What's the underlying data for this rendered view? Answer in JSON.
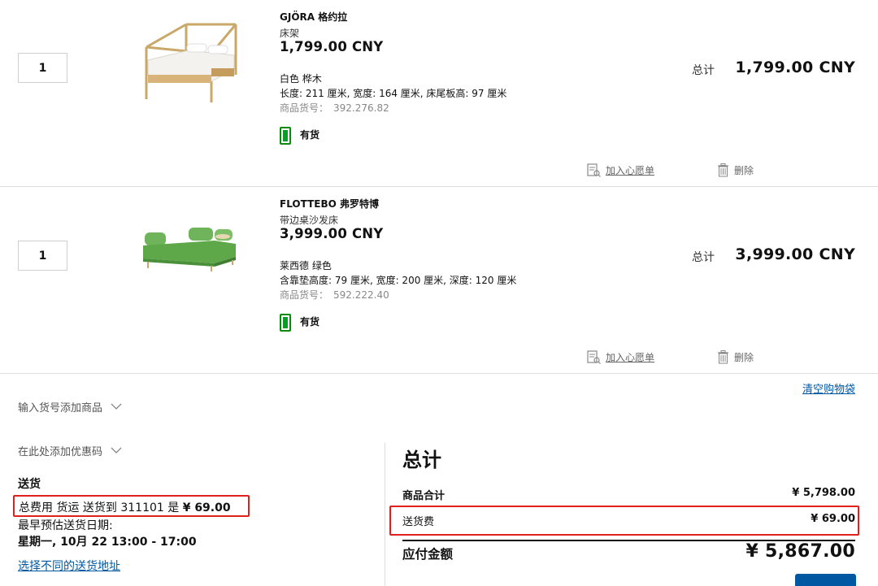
{
  "products": [
    {
      "quantity": "1",
      "name": "GJÖRA 格约拉",
      "type": "床架",
      "price": "1,799.00 CNY",
      "color": "白色 桦木",
      "dimensions": "长度: 211 厘米, 宽度: 164 厘米, 床尾板高: 97 厘米",
      "article_label": "商品货号：",
      "article_number": "392.276.82",
      "stock": "有货",
      "total_label": "总计",
      "total_value": "1,799.00 CNY",
      "wishlist_label": "加入心愿单",
      "delete_label": "删除"
    },
    {
      "quantity": "1",
      "name": "FLOTTEBO 弗罗特博",
      "type": "带边桌沙发床",
      "price": "3,999.00 CNY",
      "color": "莱西德 绿色",
      "dimensions": "含靠垫高度: 79 厘米, 宽度: 200 厘米, 深度: 120 厘米",
      "article_label": "商品货号：",
      "article_number": "592.222.40",
      "stock": "有货",
      "total_label": "总计",
      "total_value": "3,999.00 CNY",
      "wishlist_label": "加入心愿单",
      "delete_label": "删除"
    }
  ],
  "cart_actions": {
    "clear_cart": "清空购物袋",
    "add_by_article": "输入货号添加商品",
    "add_promo": "在此处添加优惠码"
  },
  "delivery": {
    "title": "送货",
    "fee_text": "总费用 货运 送货到 311101 是 ",
    "fee_amount": "¥ 69.00",
    "earliest_label": "最早预估送货日期:",
    "earliest_date": "星期一, 10月 22 13:00 - 17:00",
    "change_address": "选择不同的送货地址"
  },
  "summary": {
    "title": "总计",
    "subtotal_label": "商品合计",
    "subtotal_value": "¥ 5,798.00",
    "delivery_label": "送货费",
    "delivery_value": "¥ 69.00",
    "grand_label": "应付金额",
    "grand_value": "¥ 5,867.00"
  },
  "colors": {
    "brand_blue": "#0058a3",
    "highlight_red": "#e0201c",
    "stock_green": "#0a9d2a"
  }
}
